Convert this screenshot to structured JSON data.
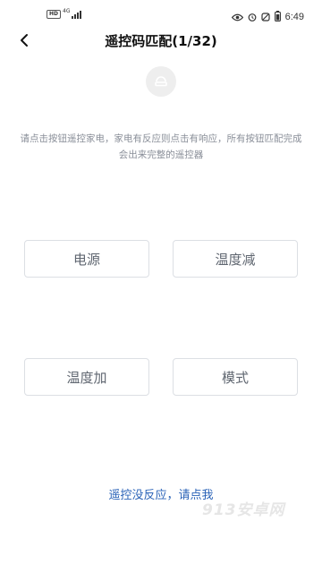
{
  "status_bar": {
    "hd_badge": "HD",
    "network": "4G",
    "time": "6:49",
    "icons": [
      "eye-icon",
      "alarm-icon",
      "mute-icon",
      "battery-icon"
    ]
  },
  "nav": {
    "back_icon": "chevron-left-icon",
    "title": "遥控码匹配(1/32)"
  },
  "device_icon": "device-icon",
  "instruction": "请点击按钮遥控家电，家电有反应则点击有响应，所有按钮匹配完成会出来完整的遥控器",
  "buttons": {
    "power": "电源",
    "temp_down": "温度减",
    "temp_up": "温度加",
    "mode": "模式"
  },
  "no_response_link": "遥控没反应，请点我",
  "watermark": "913安卓网",
  "colors": {
    "link": "#2c64b8",
    "instruction_text": "#8a8f99",
    "button_border": "#dcdfe4",
    "button_text": "#5f6670"
  }
}
